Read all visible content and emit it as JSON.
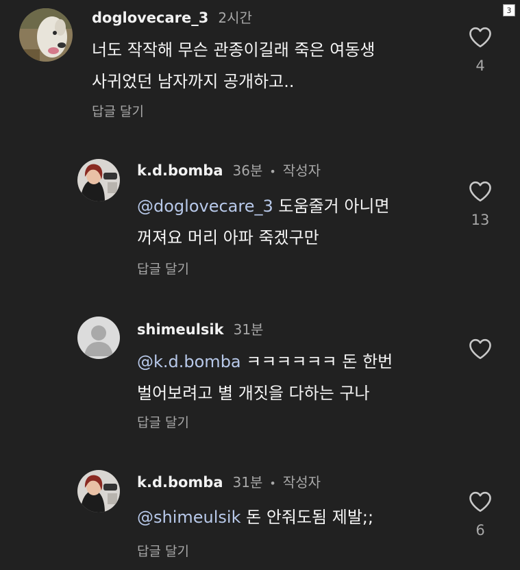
{
  "page_badge": "3",
  "comments": [
    {
      "username": "doglovecare_3",
      "time": "2시간",
      "line1": "너도 작작해 무슨 관종이길래 죽은 여동생",
      "line2": "사귀었던 남자까지 공개하고..",
      "reply_label": "답글 달기",
      "likes": "4",
      "avatar_icon": "dog-photo-avatar"
    },
    {
      "username": "k.d.bomba",
      "time": "36분",
      "separator": "•",
      "author_tag": "작성자",
      "mention": "@doglovecare_3",
      "line1_rest": " 도움줄거 아니면",
      "line2": "꺼져요 머리 아파 죽겠구만",
      "reply_label": "답글 달기",
      "likes": "13",
      "avatar_icon": "person-photo-avatar"
    },
    {
      "username": "shimeulsik",
      "time": "31분",
      "mention": "@k.d.bomba",
      "line1_rest": " ㅋㅋㅋㅋㅋㅋ 돈 한번",
      "line2": "벌어보려고 별 개짓을 다하는 구나",
      "reply_label": "답글 달기",
      "likes": "",
      "avatar_icon": "default-user-avatar"
    },
    {
      "username": "k.d.bomba",
      "time": "31분",
      "separator": "•",
      "author_tag": "작성자",
      "mention": "@shimeulsik",
      "line1_rest": " 돈 안줘도됨 제발;;",
      "reply_label": "답글 달기",
      "likes": "6",
      "avatar_icon": "person-photo-avatar"
    }
  ],
  "colors": {
    "background": "#212121",
    "text": "#f5f5f5",
    "muted": "#a8a8a8",
    "mention": "#b8c9ea"
  }
}
